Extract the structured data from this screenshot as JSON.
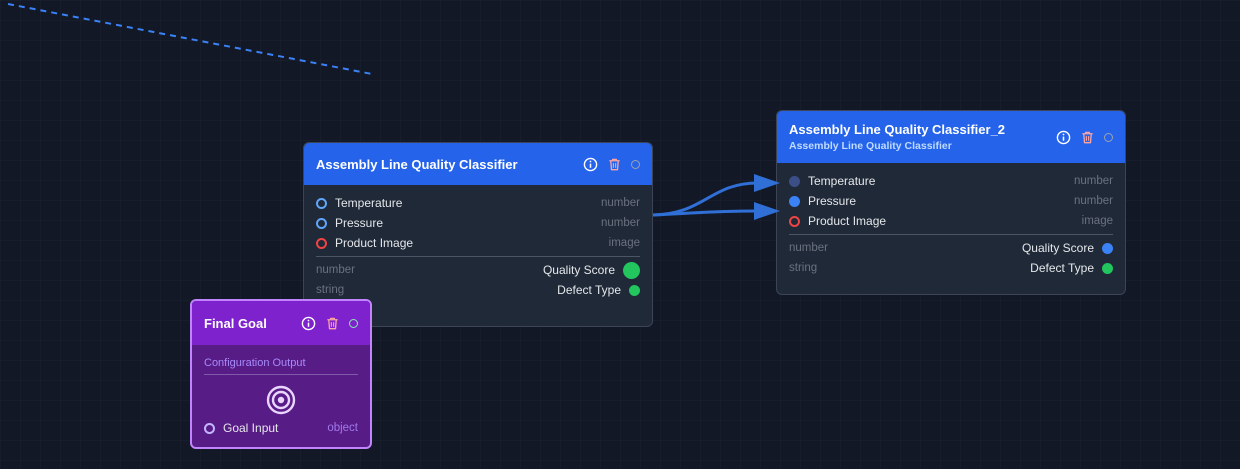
{
  "nodes": {
    "classifier": {
      "title": "Assembly Line Quality Classifier",
      "inputs": [
        {
          "label": "Temperature",
          "type": "number"
        },
        {
          "label": "Pressure",
          "type": "number"
        },
        {
          "label": "Product Image",
          "type": "image"
        }
      ],
      "outputs": [
        {
          "type": "number",
          "label": "Quality Score"
        },
        {
          "type": "string",
          "label": "Defect Type"
        }
      ]
    },
    "classifier_2": {
      "title": "Assembly Line Quality Classifier_2",
      "subtitle": "Assembly Line Quality Classifier",
      "inputs": [
        {
          "label": "Temperature",
          "type": "number"
        },
        {
          "label": "Pressure",
          "type": "number"
        },
        {
          "label": "Product Image",
          "type": "image"
        }
      ],
      "outputs": [
        {
          "type": "number",
          "label": "Quality Score"
        },
        {
          "type": "string",
          "label": "Defect Type"
        }
      ]
    },
    "final_goal": {
      "title": "Final Goal",
      "section_label": "Configuration Output",
      "input": {
        "label": "Goal Input",
        "type": "object"
      }
    }
  },
  "icons": {
    "info": "info-icon",
    "delete": "trash-icon",
    "status": "status-circle-icon",
    "goal": "target-icon"
  },
  "colors": {
    "canvas_bg": "#121826",
    "node_bg": "#1f2937",
    "node_header": "#2563eb",
    "goal_header": "#7e22ce",
    "goal_body": "#581c87",
    "edge": "#2f6fd6",
    "port_green": "#22c55e",
    "port_red": "#ef4444"
  }
}
